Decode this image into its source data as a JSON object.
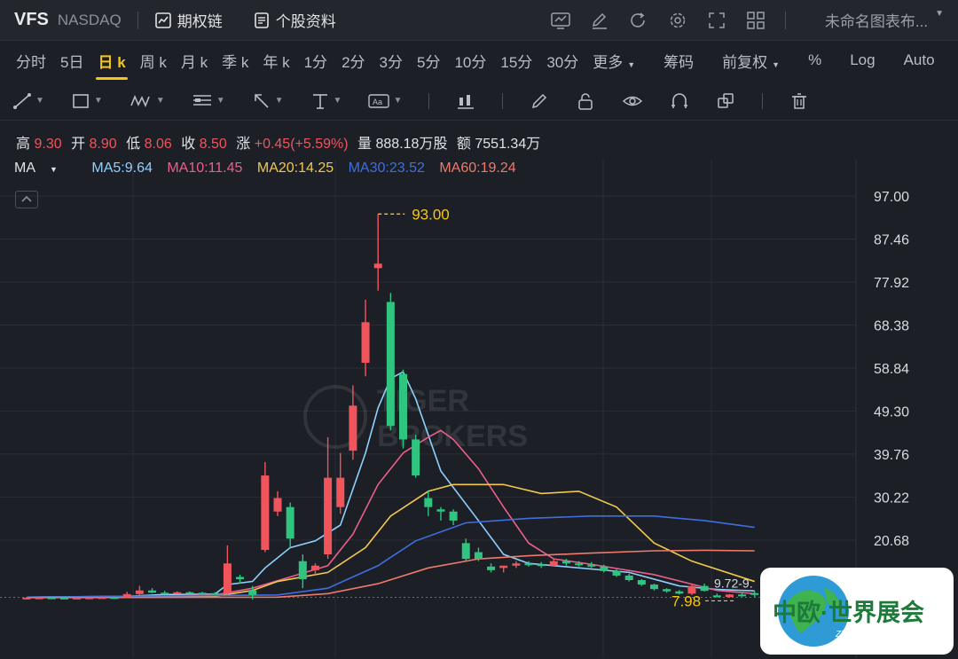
{
  "header": {
    "symbol": "VFS",
    "exchange": "NASDAQ",
    "options_chain": "期权链",
    "stock_profile": "个股资料",
    "layout_name": "未命名图表布..."
  },
  "timeframes": [
    "分时",
    "5日",
    "日 k",
    "周 k",
    "月 k",
    "季 k",
    "年 k",
    "1分",
    "2分",
    "3分",
    "5分",
    "10分",
    "15分",
    "30分",
    "更多"
  ],
  "active_timeframe": "日 k",
  "chart_options": {
    "chips": "筹码",
    "adjust": "前复权",
    "percent": "%",
    "log": "Log",
    "auto": "Auto"
  },
  "quote": {
    "high_label": "高",
    "high": "9.30",
    "open_label": "开",
    "open": "8.90",
    "low_label": "低",
    "low": "8.06",
    "close_label": "收",
    "close": "8.50",
    "change_label": "涨",
    "change": "+0.45(+5.59%)",
    "volume_label": "量",
    "volume": "888.18万股",
    "amount_label": "额",
    "amount": "7551.34万"
  },
  "ma": {
    "label": "MA",
    "ma5": "MA5:9.64",
    "ma10": "MA10:11.45",
    "ma20": "MA20:14.25",
    "ma30": "MA30:23.52",
    "ma60": "MA60:19.24"
  },
  "colors": {
    "up": "#f0555c",
    "down": "#2fc47f",
    "ma5": "#8ed1ff",
    "ma10": "#ec5f8c",
    "ma20": "#f2c94c",
    "ma30": "#3e6fe0",
    "ma60": "#f07a6a",
    "accent": "#f5c518"
  },
  "price_axis": [
    "97.00",
    "87.46",
    "77.92",
    "68.38",
    "58.84",
    "49.30",
    "39.76",
    "30.22",
    "20.68"
  ],
  "annotations": {
    "high_marker": "93.00",
    "low_marker": "7.98",
    "range_label": "9.72-9."
  },
  "watermark": {
    "line1": "TIGER",
    "line2": "BROKERS"
  },
  "logo": {
    "cn": "中欧·世界展会",
    "en": "ZhongOu Expo"
  },
  "chart_data": {
    "type": "candlestick",
    "ylim": [
      0,
      97
    ],
    "candles": [
      {
        "o": 7.9,
        "h": 8.0,
        "l": 7.8,
        "c": 7.9
      },
      {
        "o": 7.9,
        "h": 8.0,
        "l": 7.8,
        "c": 7.95
      },
      {
        "o": 7.95,
        "h": 8.05,
        "l": 7.85,
        "c": 7.9
      },
      {
        "o": 7.9,
        "h": 8.0,
        "l": 7.8,
        "c": 7.85
      },
      {
        "o": 7.85,
        "h": 7.95,
        "l": 7.75,
        "c": 7.9
      },
      {
        "o": 7.9,
        "h": 8.0,
        "l": 7.8,
        "c": 7.95
      },
      {
        "o": 7.95,
        "h": 8.1,
        "l": 7.85,
        "c": 8.0
      },
      {
        "o": 8.0,
        "h": 8.1,
        "l": 7.9,
        "c": 7.95
      },
      {
        "o": 7.95,
        "h": 9.2,
        "l": 7.9,
        "c": 8.7
      },
      {
        "o": 8.7,
        "h": 10.5,
        "l": 8.5,
        "c": 9.5
      },
      {
        "o": 9.5,
        "h": 10.0,
        "l": 8.9,
        "c": 9.0
      },
      {
        "o": 9.0,
        "h": 9.4,
        "l": 8.6,
        "c": 8.9
      },
      {
        "o": 8.9,
        "h": 9.3,
        "l": 8.7,
        "c": 9.1
      },
      {
        "o": 9.1,
        "h": 9.3,
        "l": 8.8,
        "c": 9.0
      },
      {
        "o": 9.0,
        "h": 9.2,
        "l": 8.7,
        "c": 8.9
      },
      {
        "o": 8.9,
        "h": 9.1,
        "l": 8.6,
        "c": 8.8
      },
      {
        "o": 8.8,
        "h": 19.5,
        "l": 8.6,
        "c": 15.5
      },
      {
        "o": 12.5,
        "h": 13.0,
        "l": 11.0,
        "c": 12.0
      },
      {
        "o": 9.5,
        "h": 10.5,
        "l": 7.5,
        "c": 8.5
      },
      {
        "o": 18.5,
        "h": 38.0,
        "l": 18.0,
        "c": 35.0
      },
      {
        "o": 27.0,
        "h": 31.5,
        "l": 26.0,
        "c": 30.0
      },
      {
        "o": 28.0,
        "h": 29.0,
        "l": 19.0,
        "c": 21.0
      },
      {
        "o": 16.0,
        "h": 17.5,
        "l": 10.0,
        "c": 12.0
      },
      {
        "o": 14.0,
        "h": 15.5,
        "l": 13.0,
        "c": 15.0
      },
      {
        "o": 17.5,
        "h": 43.5,
        "l": 16.5,
        "c": 34.5
      },
      {
        "o": 28.0,
        "h": 40.0,
        "l": 26.5,
        "c": 34.5
      },
      {
        "o": 40.5,
        "h": 55.0,
        "l": 38.5,
        "c": 50.5
      },
      {
        "o": 60.0,
        "h": 74.0,
        "l": 57.0,
        "c": 69.0
      },
      {
        "o": 81.0,
        "h": 93.0,
        "l": 76.0,
        "c": 82.0
      },
      {
        "o": 73.5,
        "h": 75.5,
        "l": 45.0,
        "c": 46.0
      },
      {
        "o": 57.5,
        "h": 58.5,
        "l": 41.0,
        "c": 43.0
      },
      {
        "o": 43.0,
        "h": 44.0,
        "l": 34.5,
        "c": 35.0
      },
      {
        "o": 30.0,
        "h": 31.5,
        "l": 26.0,
        "c": 28.0
      },
      {
        "o": 27.5,
        "h": 28.0,
        "l": 25.0,
        "c": 27.0
      },
      {
        "o": 27.0,
        "h": 27.5,
        "l": 24.0,
        "c": 25.0
      },
      {
        "o": 20.0,
        "h": 21.0,
        "l": 16.0,
        "c": 16.5
      },
      {
        "o": 18.0,
        "h": 19.0,
        "l": 16.0,
        "c": 16.5
      },
      {
        "o": 14.8,
        "h": 15.5,
        "l": 13.5,
        "c": 14.0
      },
      {
        "o": 14.5,
        "h": 15.0,
        "l": 13.5,
        "c": 15.0
      },
      {
        "o": 15.0,
        "h": 16.0,
        "l": 14.5,
        "c": 15.5
      },
      {
        "o": 15.5,
        "h": 16.0,
        "l": 14.8,
        "c": 15.3
      },
      {
        "o": 15.3,
        "h": 15.8,
        "l": 14.5,
        "c": 15.0
      },
      {
        "o": 15.0,
        "h": 16.5,
        "l": 14.8,
        "c": 16.0
      },
      {
        "o": 16.0,
        "h": 16.5,
        "l": 15.0,
        "c": 15.5
      },
      {
        "o": 15.5,
        "h": 16.0,
        "l": 14.8,
        "c": 15.2
      },
      {
        "o": 15.2,
        "h": 15.8,
        "l": 14.5,
        "c": 14.8
      },
      {
        "o": 14.8,
        "h": 15.2,
        "l": 13.5,
        "c": 13.8
      },
      {
        "o": 13.8,
        "h": 14.2,
        "l": 12.5,
        "c": 12.8
      },
      {
        "o": 12.8,
        "h": 13.2,
        "l": 11.5,
        "c": 11.8
      },
      {
        "o": 11.8,
        "h": 12.0,
        "l": 10.5,
        "c": 10.8
      },
      {
        "o": 10.8,
        "h": 11.0,
        "l": 9.5,
        "c": 9.8
      },
      {
        "o": 9.8,
        "h": 10.0,
        "l": 9.0,
        "c": 9.3
      },
      {
        "o": 9.3,
        "h": 9.6,
        "l": 8.6,
        "c": 8.8
      },
      {
        "o": 8.8,
        "h": 11.0,
        "l": 8.5,
        "c": 10.5
      },
      {
        "o": 10.5,
        "h": 11.0,
        "l": 9.3,
        "c": 9.4
      },
      {
        "o": 8.4,
        "h": 8.8,
        "l": 7.98,
        "c": 8.05
      },
      {
        "o": 8.05,
        "h": 8.7,
        "l": 7.9,
        "c": 8.6
      },
      {
        "o": 8.6,
        "h": 9.0,
        "l": 8.1,
        "c": 8.3
      },
      {
        "o": 8.9,
        "h": 9.3,
        "l": 8.06,
        "c": 8.5
      }
    ],
    "ma_series": [
      {
        "name": "MA5",
        "color": "#8ed1ff",
        "points": [
          [
            0,
            8.0
          ],
          [
            8,
            8.2
          ],
          [
            11,
            8.6
          ],
          [
            15,
            8.7
          ],
          [
            16,
            10.8
          ],
          [
            18,
            11.5
          ],
          [
            19,
            14.5
          ],
          [
            21,
            19.0
          ],
          [
            23,
            20.5
          ],
          [
            25,
            24.0
          ],
          [
            27,
            40.0
          ],
          [
            28,
            50.0
          ],
          [
            29,
            56.5
          ],
          [
            30,
            58.0
          ],
          [
            31,
            52.0
          ],
          [
            33,
            36.0
          ],
          [
            36,
            25.0
          ],
          [
            38,
            17.5
          ],
          [
            40,
            15.5
          ],
          [
            48,
            13.5
          ],
          [
            52,
            10.5
          ],
          [
            55,
            9.72
          ],
          [
            58,
            9.4
          ]
        ]
      },
      {
        "name": "MA10",
        "color": "#ec5f8c",
        "points": [
          [
            0,
            8.0
          ],
          [
            10,
            8.2
          ],
          [
            15,
            8.5
          ],
          [
            18,
            10.0
          ],
          [
            21,
            12.5
          ],
          [
            24,
            15.0
          ],
          [
            26,
            22.0
          ],
          [
            28,
            33.0
          ],
          [
            30,
            40.0
          ],
          [
            32,
            43.5
          ],
          [
            33,
            45.0
          ],
          [
            34,
            43.0
          ],
          [
            36,
            36.5
          ],
          [
            38,
            28.0
          ],
          [
            40,
            20.0
          ],
          [
            42,
            16.5
          ],
          [
            45,
            15.3
          ],
          [
            50,
            13.0
          ],
          [
            55,
            9.5
          ],
          [
            58,
            8.8
          ]
        ]
      },
      {
        "name": "MA20",
        "color": "#f2c94c",
        "points": [
          [
            0,
            8.0
          ],
          [
            15,
            8.2
          ],
          [
            18,
            9.5
          ],
          [
            20,
            11.5
          ],
          [
            24,
            13.5
          ],
          [
            27,
            19.0
          ],
          [
            29,
            26.0
          ],
          [
            32,
            31.5
          ],
          [
            34,
            33.0
          ],
          [
            38,
            33.0
          ],
          [
            41,
            31.0
          ],
          [
            44,
            31.5
          ],
          [
            47,
            28.0
          ],
          [
            50,
            20.0
          ],
          [
            53,
            16.0
          ],
          [
            58,
            11.5
          ]
        ]
      },
      {
        "name": "MA30",
        "color": "#3e6fe0",
        "points": [
          [
            0,
            8.0
          ],
          [
            20,
            8.5
          ],
          [
            24,
            10.0
          ],
          [
            28,
            15.0
          ],
          [
            31,
            20.5
          ],
          [
            35,
            24.5
          ],
          [
            40,
            25.5
          ],
          [
            45,
            26.0
          ],
          [
            50,
            26.0
          ],
          [
            54,
            25.0
          ],
          [
            58,
            23.5
          ]
        ]
      },
      {
        "name": "MA60",
        "color": "#f07a6a",
        "points": [
          [
            0,
            7.9
          ],
          [
            20,
            8.0
          ],
          [
            24,
            8.8
          ],
          [
            28,
            11.0
          ],
          [
            32,
            14.5
          ],
          [
            36,
            16.5
          ],
          [
            40,
            17.2
          ],
          [
            45,
            17.8
          ],
          [
            50,
            18.3
          ],
          [
            54,
            18.4
          ],
          [
            58,
            18.3
          ]
        ]
      }
    ]
  }
}
